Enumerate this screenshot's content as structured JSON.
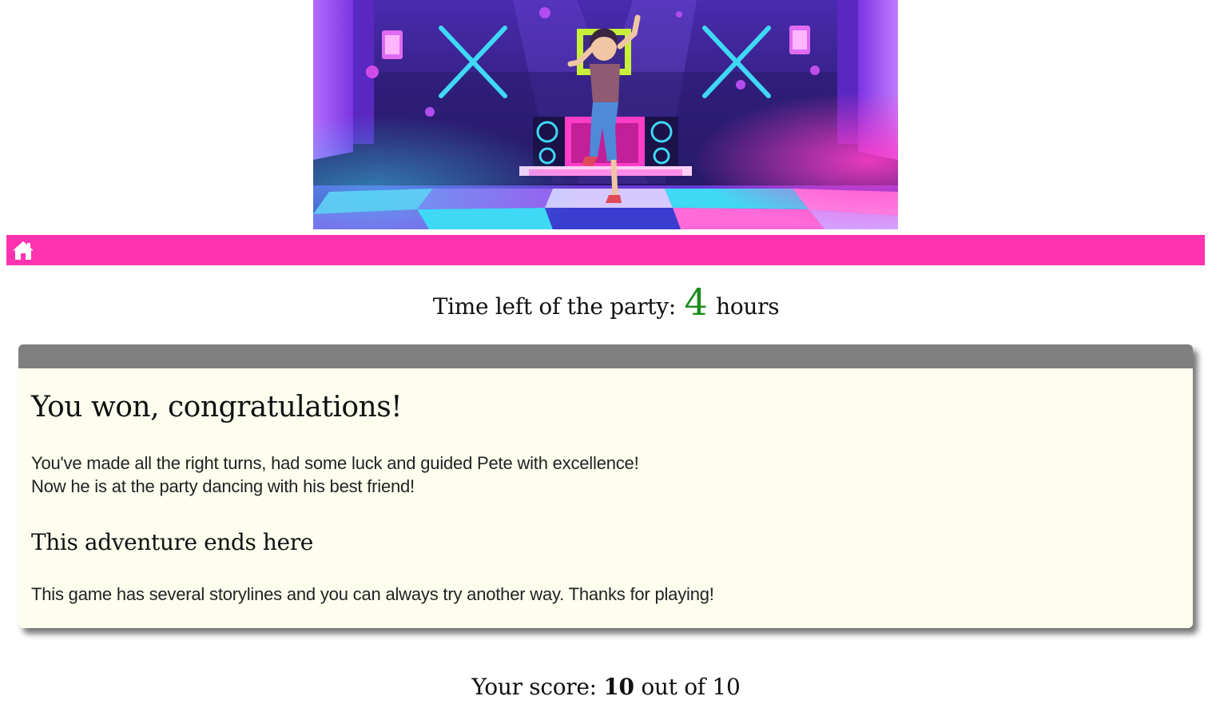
{
  "hero": {
    "description_icon": "dancing-girl-illustration",
    "colors": {
      "bg_dark": "#2a1b6e",
      "neon_purple": "#8a3cf0",
      "neon_cyan": "#3fd8f5",
      "neon_pink": "#ff3ec8",
      "neon_green": "#c8f03a"
    }
  },
  "nav": {
    "home_icon": "home-icon",
    "background": "#ff33b0"
  },
  "timer": {
    "prefix": "Time left of the party:",
    "value": "4",
    "suffix": "hours",
    "value_color": "#1c8c1c"
  },
  "story": {
    "header_color": "#808080",
    "background": "#fefeef",
    "title": "You won, congratulations!",
    "line1": "You've made all the right turns, had some luck and guided Pete with excellence!",
    "line2": "Now he is at the party dancing with his best friend!",
    "subtitle": "This adventure ends here",
    "closing": "This game has several storylines and you can always try another way. Thanks for playing!"
  },
  "score": {
    "prefix": "Your score:",
    "value": "10",
    "suffix": "out of 10"
  }
}
